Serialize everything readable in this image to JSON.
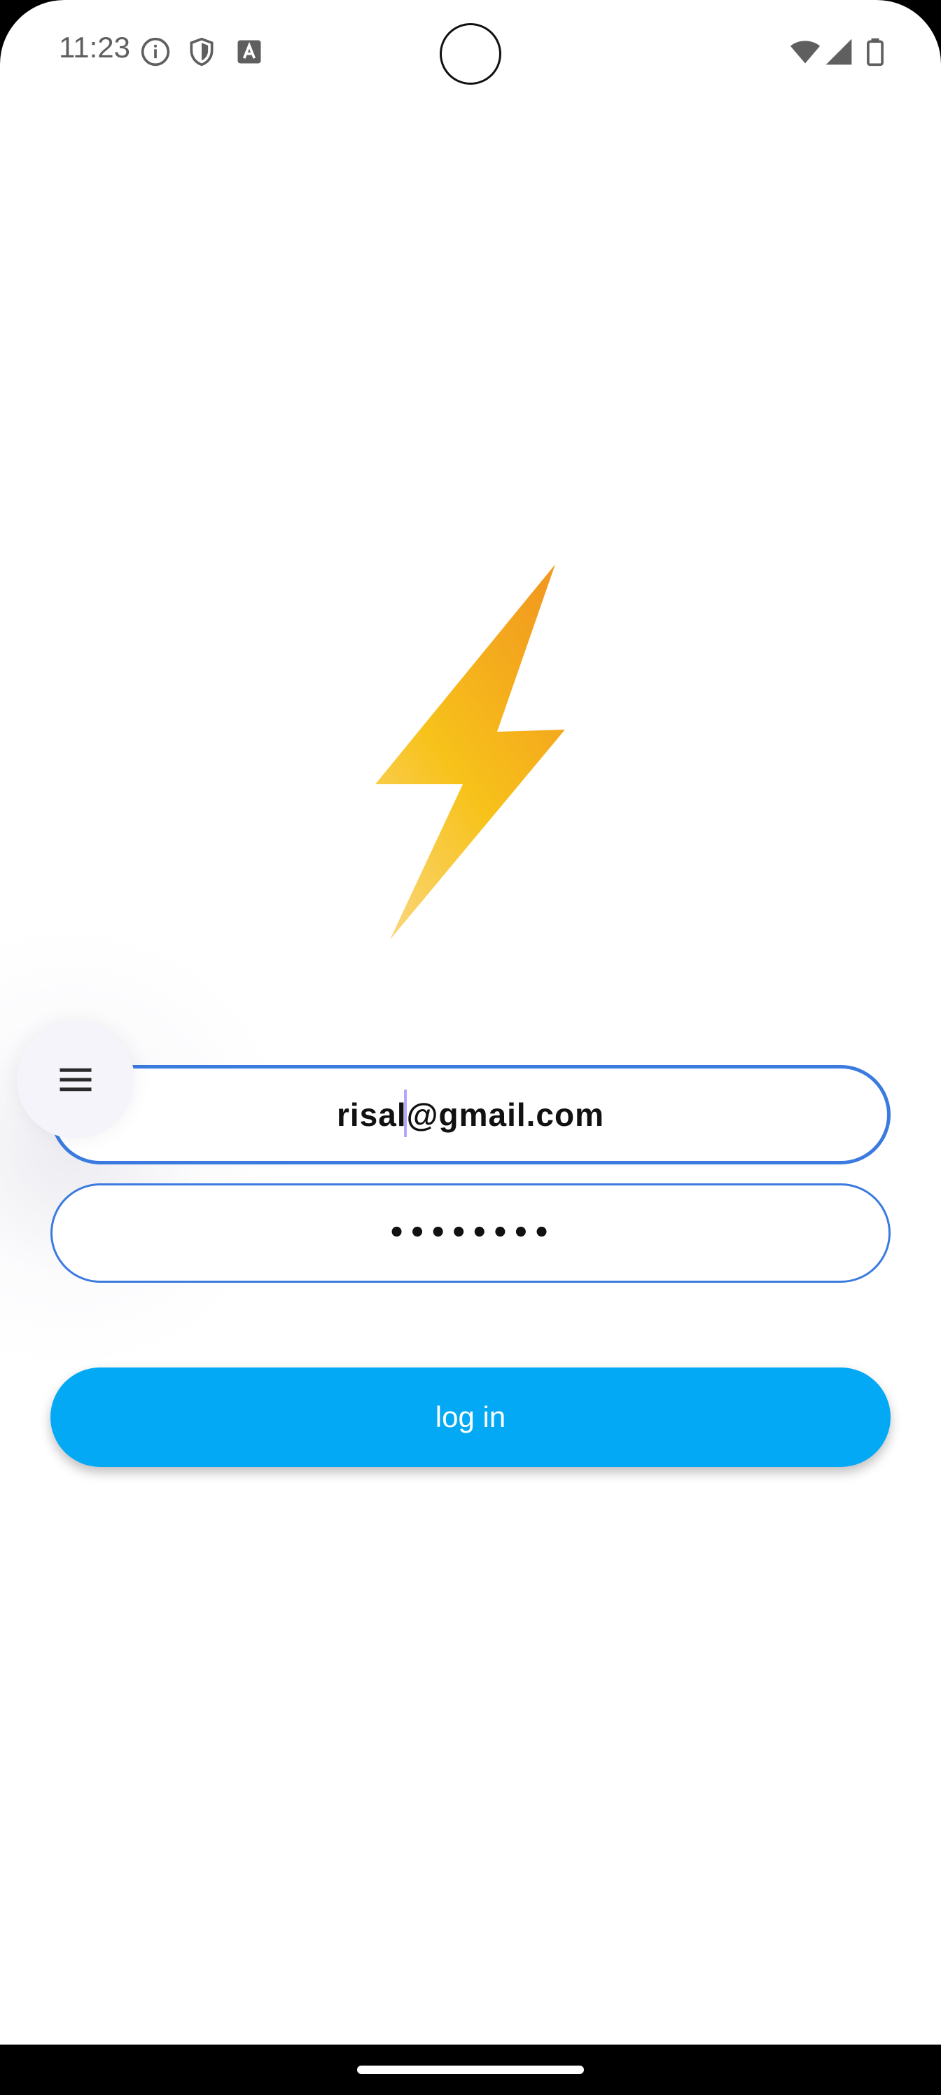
{
  "status_bar": {
    "time": "11:23",
    "icons": [
      "info-icon",
      "shield-icon",
      "font-icon",
      "wifi-icon",
      "signal-icon",
      "battery-icon"
    ]
  },
  "logo": {
    "icon": "lightning-bolt-icon",
    "colors": [
      "#f29a1f",
      "#f7c21a",
      "#fad67a"
    ]
  },
  "login_form": {
    "email_value": "risal@gmail.com",
    "password_value": "••••••••",
    "login_label": "log in",
    "accent": "#3b7be0",
    "button_color": "#03a9f4"
  },
  "floating_menu": {
    "icon": "hamburger-menu-icon"
  }
}
